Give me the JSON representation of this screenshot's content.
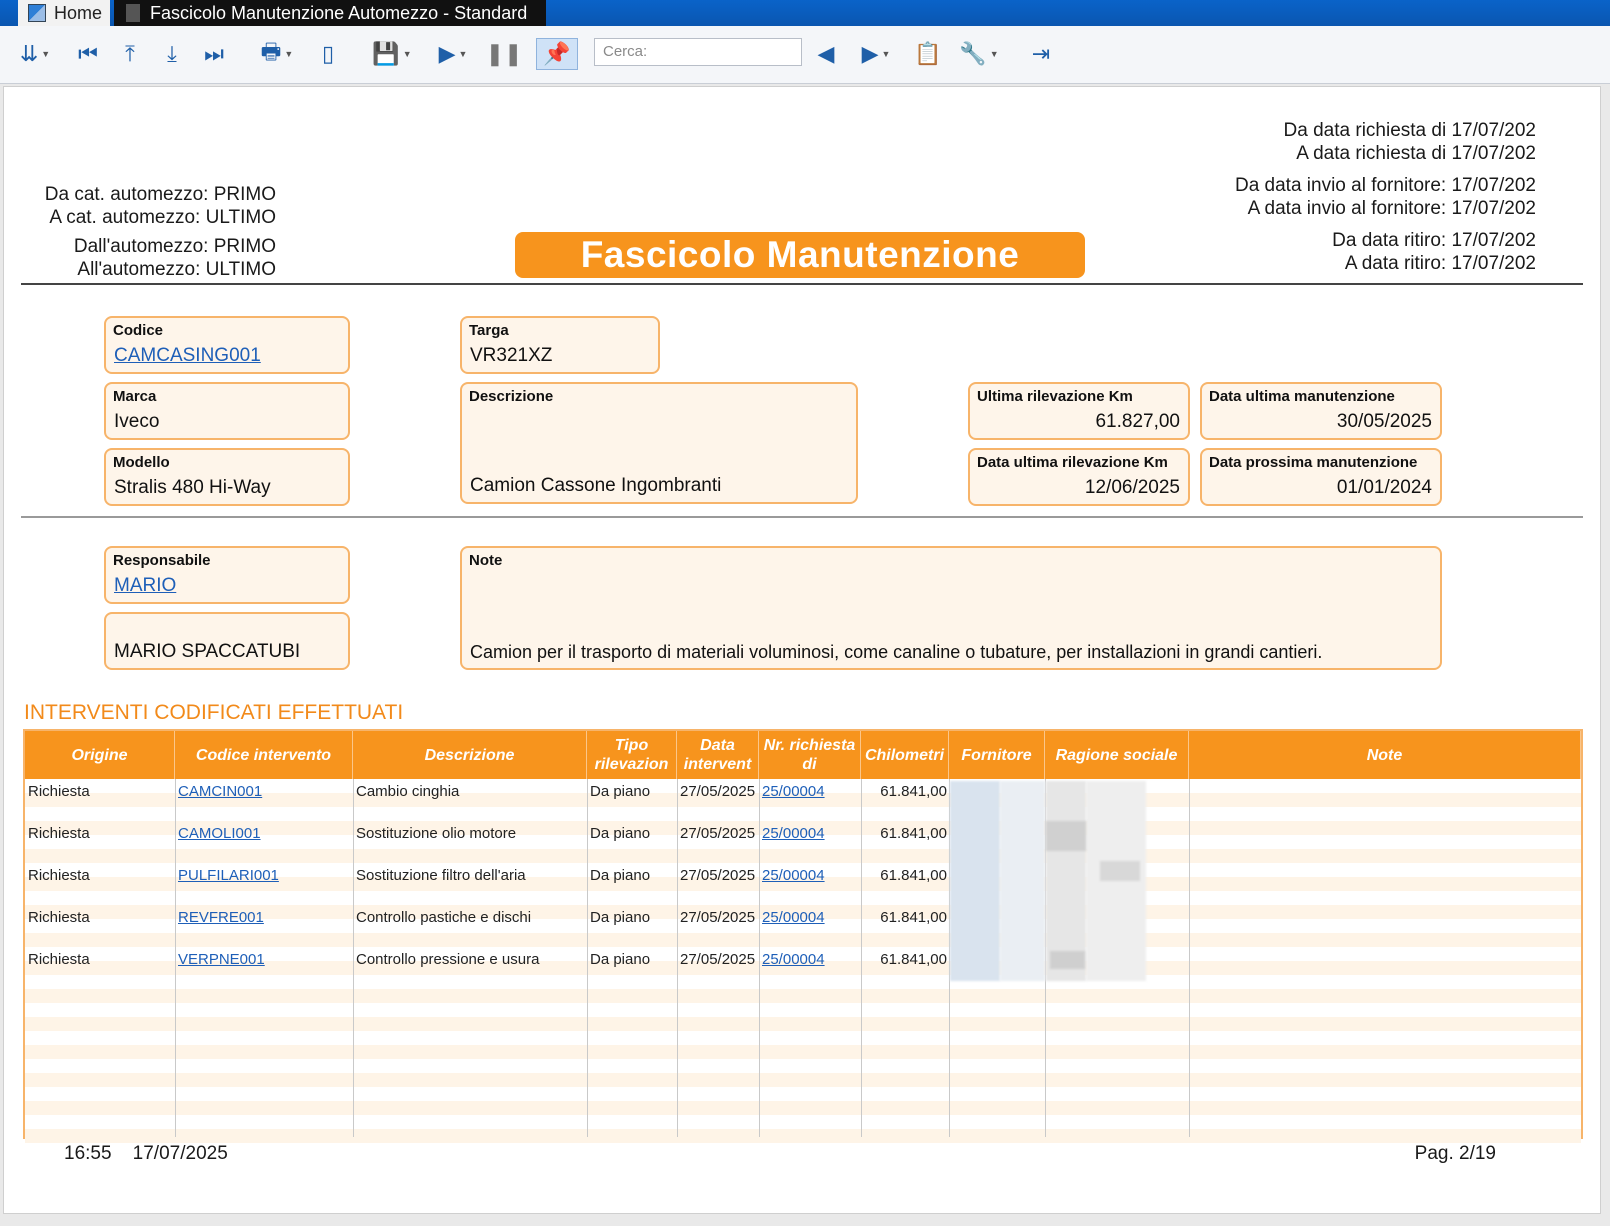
{
  "tabs": {
    "home_label": "Home",
    "active_label": "Fascicolo Manutenzione Automezzo - Standard"
  },
  "toolbar": {
    "search_placeholder": "Cerca:"
  },
  "header_left": {
    "da_cat": "Da cat. automezzo: PRIMO",
    "a_cat": "A cat. automezzo: ULTIMO",
    "dall_automezzo": "Dall'automezzo: PRIMO",
    "all_automezzo": "All'automezzo: ULTIMO"
  },
  "header_right": {
    "da_richiesta": "Da data richiesta di 17/07/202",
    "a_richiesta": "A data richiesta di 17/07/202",
    "da_invio": "Da data invio al fornitore: 17/07/202",
    "a_invio": "A data invio al fornitore: 17/07/202",
    "da_ritiro": "Da data ritiro: 17/07/202",
    "a_ritiro": "A data ritiro: 17/07/202"
  },
  "title": "Fascicolo Manutenzione",
  "fields": {
    "codice": {
      "label": "Codice",
      "value": "CAMCASING001"
    },
    "targa": {
      "label": "Targa",
      "value": "VR321XZ"
    },
    "marca": {
      "label": "Marca",
      "value": "Iveco"
    },
    "descrizione": {
      "label": "Descrizione",
      "value": "Camion Cassone Ingombranti"
    },
    "ultima_km": {
      "label": "Ultima rilevazione Km",
      "value": "61.827,00"
    },
    "data_ultima_man": {
      "label": "Data ultima manutenzione",
      "value": "30/05/2025"
    },
    "modello": {
      "label": "Modello",
      "value": "Stralis 480 Hi-Way"
    },
    "data_ultima_km": {
      "label": "Data ultima rilevazione Km",
      "value": "12/06/2025"
    },
    "data_prossima_man": {
      "label": "Data prossima manutenzione",
      "value": "01/01/2024"
    },
    "responsabile": {
      "label": "Responsabile",
      "value": "MARIO"
    },
    "responsabile_nome": {
      "value": "MARIO SPACCATUBI"
    },
    "note": {
      "label": "Note",
      "value": "Camion per il trasporto di materiali voluminosi, come canaline o tubature, per installazioni in grandi cantieri."
    }
  },
  "section_title": "INTERVENTI CODIFICATI EFFETTUATI",
  "table": {
    "headers": [
      "Origine",
      "Codice intervento",
      "Descrizione",
      "Tipo rilevazion",
      "Data intervent",
      "Nr. richiesta di",
      "Chilometri",
      "Fornitore",
      "Ragione sociale",
      "Note"
    ],
    "rows": [
      [
        "Richiesta",
        "CAMCIN001",
        "Cambio cinghia",
        "Da piano",
        "27/05/2025",
        "25/00004",
        "61.841,00"
      ],
      [
        "Richiesta",
        "CAMOLI001",
        "Sostituzione olio motore",
        "Da piano",
        "27/05/2025",
        "25/00004",
        "61.841,00"
      ],
      [
        "Richiesta",
        "PULFILARI001",
        "Sostituzione filtro dell'aria",
        "Da piano",
        "27/05/2025",
        "25/00004",
        "61.841,00"
      ],
      [
        "Richiesta",
        "REVFRE001",
        "Controllo pastiche e dischi",
        "Da piano",
        "27/05/2025",
        "25/00004",
        "61.841,00"
      ],
      [
        "Richiesta",
        "VERPNE001",
        "Controllo pressione e usura",
        "Da piano",
        "27/05/2025",
        "25/00004",
        "61.841,00"
      ]
    ]
  },
  "footer": {
    "time": "16:55",
    "date": "17/07/2025",
    "page": "Pag. 2/19"
  }
}
